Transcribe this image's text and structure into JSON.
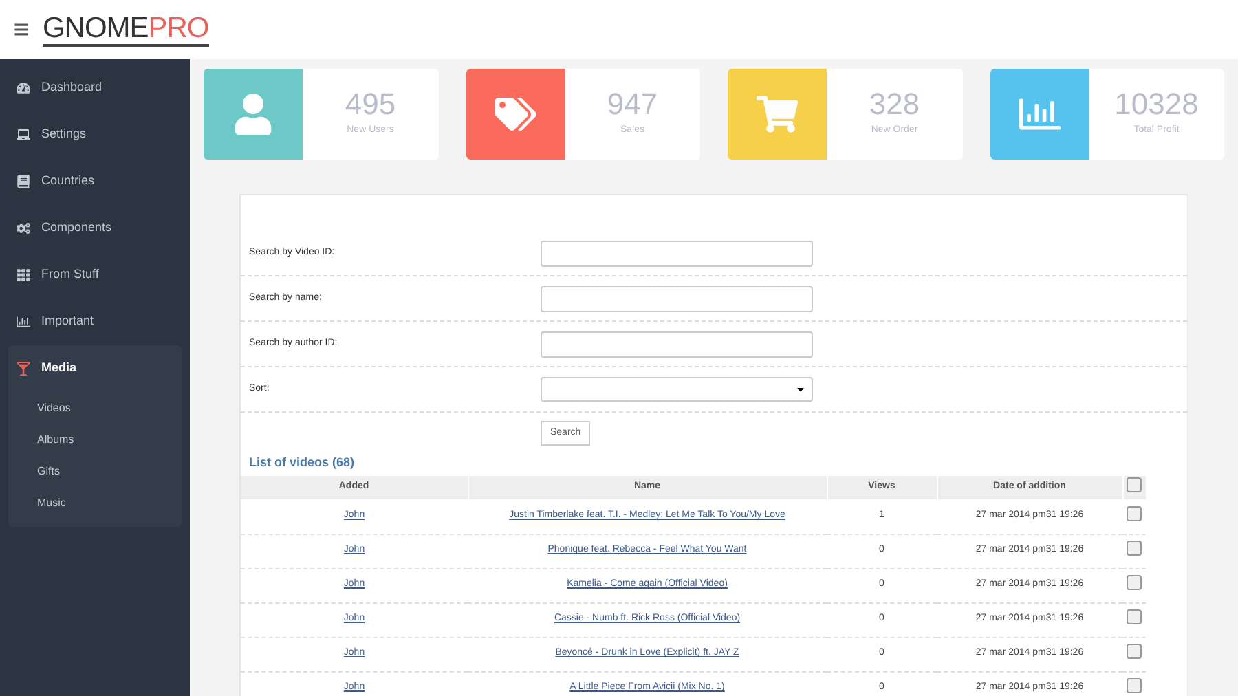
{
  "brand": {
    "part_1": "GNOME",
    "part_2": "PRO"
  },
  "sidebar": {
    "items": [
      {
        "label": "Dashboard",
        "selected": false
      },
      {
        "label": "Settings",
        "selected": false
      },
      {
        "label": "Countries",
        "selected": false
      },
      {
        "label": "Components",
        "selected": false
      },
      {
        "label": "From Stuff",
        "selected": false
      },
      {
        "label": "Important",
        "selected": false
      },
      {
        "label": "Media",
        "selected": true,
        "expanded": true,
        "children": [
          {
            "label": "Videos"
          },
          {
            "label": "Albums"
          },
          {
            "label": "Gifts"
          },
          {
            "label": "Music"
          }
        ]
      }
    ]
  },
  "stats": [
    {
      "value": "495",
      "label": "New Users",
      "color": "#6cc9c7"
    },
    {
      "value": "947",
      "label": "Sales",
      "color": "#fb6b5b"
    },
    {
      "value": "328",
      "label": "New Order",
      "color": "#f7d04a"
    },
    {
      "value": "10328",
      "label": "Total Profit",
      "color": "#56c3ef"
    }
  ],
  "search_form": {
    "fields": [
      {
        "kind": "text",
        "label": "Search by Video ID:"
      },
      {
        "kind": "text",
        "label": "Search by name:"
      },
      {
        "kind": "text",
        "label": "Search by author ID:"
      },
      {
        "kind": "select",
        "label": "Sort:"
      }
    ],
    "button": "Search"
  },
  "videos": {
    "title": "List of videos (68)",
    "select_all_checked": false,
    "columns": [
      "Added",
      "Name",
      "Views",
      "Date of addition"
    ],
    "rows": [
      {
        "added": "John",
        "name": "Justin Timberlake feat. T.I. - Medley: Let Me Talk To You/My Love",
        "views": "1",
        "date": "27 mar 2014 pm31 19:26",
        "checked": false
      },
      {
        "added": "John",
        "name": "Phonique feat. Rebecca - Feel What You Want",
        "views": "0",
        "date": "27 mar 2014 pm31 19:26",
        "checked": false
      },
      {
        "added": "John",
        "name": "Kamelia - Come again (Official Video)",
        "views": "0",
        "date": "27 mar 2014 pm31 19:26",
        "checked": false
      },
      {
        "added": "John",
        "name": "Cassie - Numb ft. Rick Ross (Official Video)",
        "views": "0",
        "date": "27 mar 2014 pm31 19:26",
        "checked": false
      },
      {
        "added": "John",
        "name": "Beyoncé - Drunk in Love (Explicit) ft. JAY Z",
        "views": "0",
        "date": "27 mar 2014 pm31 19:26",
        "checked": false
      },
      {
        "added": "John",
        "name": "A Little Piece From Avicii (Mix No. 1)",
        "views": "0",
        "date": "27 mar 2014 pm31 19:26",
        "checked": false
      }
    ]
  }
}
